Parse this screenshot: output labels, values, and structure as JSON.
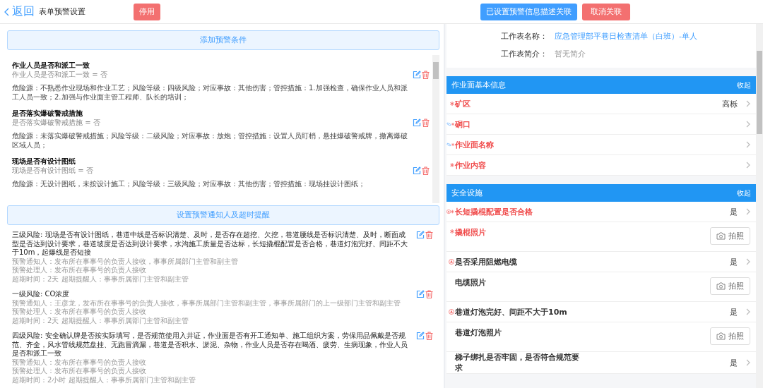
{
  "header": {
    "back": "返回",
    "title": "表单预警设置",
    "disable_button": "停用",
    "link_button": "已设置预警信息描述关联",
    "unlink_button": "取消关联"
  },
  "conditions": {
    "add_button": "添加预警条件",
    "items": [
      {
        "title": "作业人员是否和派工一致",
        "rule": "作业人员是否和派工一致 = 否",
        "description": "危险源：不熟悉作业现场和作业工艺；风险等级：四级风险；对应事故：其他伤害；管控措施：1.加强检查，确保作业人员和派工人员一致；2.加强与作业面主管工程师、队长的培训；"
      },
      {
        "title": "是否落实爆破警戒措施",
        "rule": "是否落实爆破警戒措施 = 否",
        "description": "危险源：未落实爆破警戒措施；风险等级：二级风险；对应事故：放炮；管控措施：设置人员盯梢，悬挂爆破警戒牌，撤离爆破区域人员；"
      },
      {
        "title": "现场是否有设计图纸",
        "rule": "现场是否有设计图纸 = 否",
        "description": "危险源：无设计图纸，未按设计施工；风险等级：三级风险；对应事故：其他伤害；管控措施：现场挂设计图纸；"
      }
    ]
  },
  "notifications": {
    "set_button": "设置预警通知人及超时提醒",
    "items": [
      {
        "risk": "三级风险: 现场是否有设计图纸，巷道中线是否标识清楚、及时，是否存在超挖、欠挖，巷道腰线是否标识清楚、及时，断面成型是否达到设计要求，巷道坡度是否达到设计要求，水沟施工质量是否达标，长短撬棍配置是否合格，巷道灯泡完好、间距不大于10m，起爆线是否短接",
        "notifier": "预警通知人：发布所在事事号的负责人接收，事事所属部门主管和副主管",
        "handler": "预警处理人：发布所在事事号的负责人接收",
        "timeout": "超期时间：2天 超期提醒人：事事所属部门主管和副主管"
      },
      {
        "risk": "一级风险: CO浓度",
        "notifier": "预警通知人：王彦龙，发布所在事事号的负责人接收，事事所属部门主管和副主管，事事所属部门的上一级部门主管和副主管",
        "handler": "预警处理人：发布所在事事号的负责人接收",
        "timeout": "超期时间：2天 超期提醒人：事事所属部门主管和副主管"
      },
      {
        "risk": "四级风险: 安全确认牌是否按实际填写，是否规范使用入井证，作业面是否有开工通知单、施工组织方案，劳保用品佩戴是否规范、齐全，风水管线规范盘挂、无跑冒滴漏，巷道是否积水、淤泥、杂物，作业人员是否存在喝酒、疲劳、生病现象，作业人员是否和派工一致",
        "notifier": "预警通知人：发布所在事事号的负责人接收",
        "handler": "预警处理人：发布所在事事号的负责人接收",
        "timeout": "超期时间：2小时 超期提醒人：事事所属部门主管和副主管"
      }
    ]
  },
  "form": {
    "name_label": "工作表名称：",
    "name": "应急管理部平巷日检查清单（白班）-单人",
    "intro_label": "工作表简介：",
    "intro": "暂无简介",
    "sections": [
      {
        "title": "作业面基本信息",
        "toggle": "收起",
        "rows": [
          {
            "kind": "select",
            "label": "矿区",
            "required": true,
            "linked": false,
            "alert": false,
            "value": "高栎"
          },
          {
            "kind": "select",
            "label": "硐口",
            "required": true,
            "linked": true,
            "alert": false
          },
          {
            "kind": "select",
            "label": "作业面名称",
            "required": true,
            "linked": true,
            "alert": false
          },
          {
            "kind": "select",
            "label": "作业内容",
            "required": true,
            "linked": false,
            "alert": false
          }
        ]
      },
      {
        "title": "安全设施",
        "toggle": "收起",
        "rows": [
          {
            "kind": "select",
            "label": "长短撬棍配置是否合格",
            "required": true,
            "linked": false,
            "alert": true,
            "value": "是"
          },
          {
            "kind": "photo",
            "label": "撬棍照片",
            "required": true,
            "linked": false,
            "alert": false,
            "button": "拍照"
          },
          {
            "kind": "select",
            "label": "是否采用阻燃电缆",
            "required": false,
            "linked": false,
            "alert": true,
            "value": "是"
          },
          {
            "kind": "photo",
            "label": "电缆照片",
            "required": false,
            "linked": false,
            "alert": false,
            "button": "拍照"
          },
          {
            "kind": "select",
            "label": "巷道灯泡完好、间距不大于10m",
            "required": false,
            "linked": false,
            "alert": true,
            "value": "是"
          },
          {
            "kind": "photo",
            "label": "巷道灯泡照片",
            "required": false,
            "linked": false,
            "alert": false,
            "button": "拍照"
          },
          {
            "kind": "select",
            "label": "梯子绑扎是否牢固，是否符合规范要求",
            "required": false,
            "linked": false,
            "alert": false,
            "value": "是"
          }
        ]
      }
    ]
  }
}
